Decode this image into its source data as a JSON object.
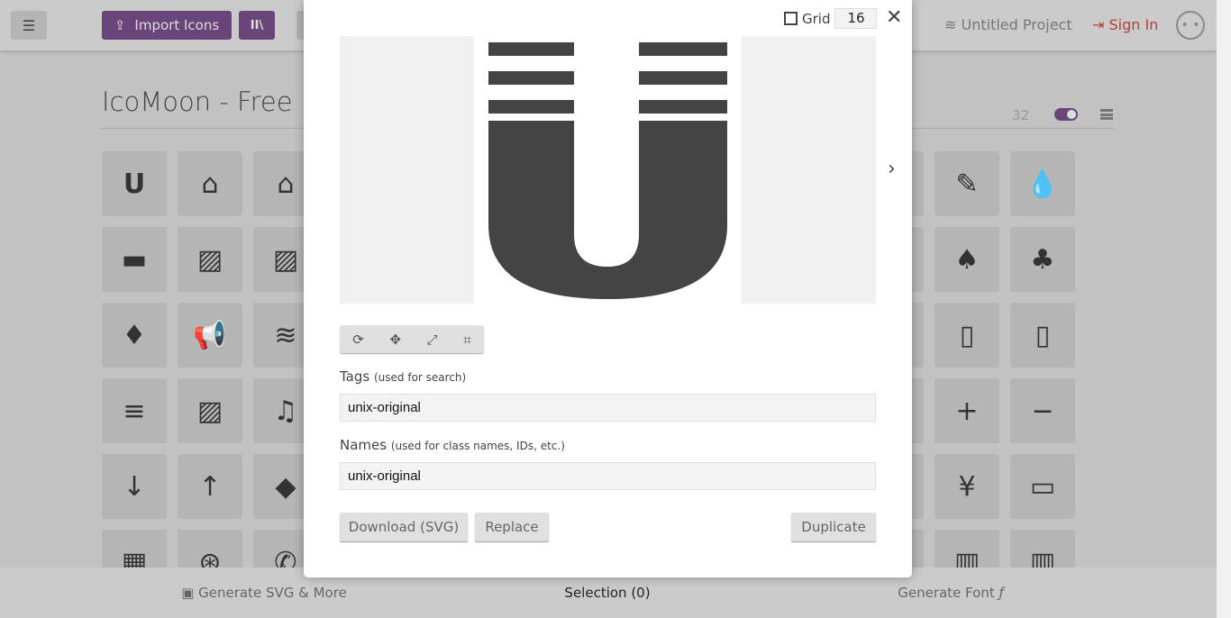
{
  "header": {
    "menu_icon": "hamburger-icon",
    "import_label": "Import Icons",
    "import_icon": "import-icon",
    "library_icon": "library-icon",
    "project": "Untitled Project",
    "project_icon": "layers-icon",
    "signin": "Sign In",
    "signin_icon": "enter-icon",
    "avatar_icon": "neutral-face-icon"
  },
  "set": {
    "title": "IcoMoon - Free",
    "size": "32"
  },
  "tiles": [
    [
      "U",
      "⌂",
      "⌂",
      "",
      "",
      "",
      "",
      "",
      "",
      "",
      "",
      "✎",
      "💧"
    ],
    [
      "▬",
      "▨",
      "▨",
      "",
      "",
      "",
      "",
      "",
      "",
      "",
      "",
      "♠",
      "♣"
    ],
    [
      "♦",
      "📢",
      "≋",
      "",
      "",
      "",
      "",
      "",
      "",
      "",
      "",
      "▯",
      "▯"
    ],
    [
      "≡",
      "▨",
      "♫",
      "",
      "",
      "",
      "",
      "",
      "",
      "",
      "",
      "+",
      "−"
    ],
    [
      "↓",
      "↑",
      "◆",
      "",
      "",
      "",
      "",
      "",
      "",
      "",
      "",
      "¥",
      "▭"
    ],
    [
      "▦",
      "⊛",
      "✆",
      "",
      "",
      "",
      "",
      "",
      "",
      "",
      "",
      "▥",
      "▥"
    ]
  ],
  "footer": {
    "generate_svg": "Generate SVG & More",
    "selection": "Selection (0)",
    "generate_font": "Generate Font",
    "font_glyph": "ƒ"
  },
  "modal": {
    "grid_label": "Grid",
    "grid_value": "16",
    "close": "✕",
    "next": "›",
    "tools": [
      "⟳",
      "✥",
      "⤢",
      "⌗"
    ],
    "tags_label": "Tags",
    "tags_hint": "(used for search)",
    "tags_value": "unix-original",
    "names_label": "Names",
    "names_hint": "(used for class names, IDs, etc.)",
    "names_value": "unix-original",
    "download": "Download (SVG)",
    "replace": "Replace",
    "duplicate": "Duplicate"
  },
  "colors": {
    "accent": "#6a4579",
    "signin": "#b5403a",
    "glyph": "#444444"
  }
}
